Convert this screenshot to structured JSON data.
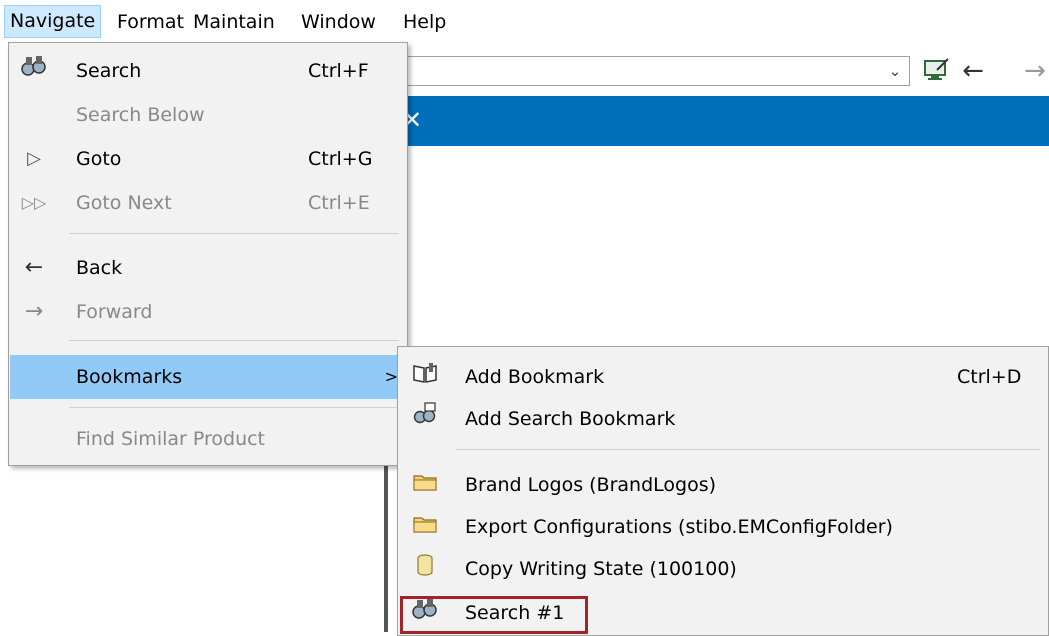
{
  "menubar": {
    "items": [
      "Navigate",
      "Format",
      "Maintain",
      "Window",
      "Help"
    ]
  },
  "toolbar": {
    "combo_arrow": "⌄",
    "icons": [
      "screen-edit-icon",
      "back-arrow-icon",
      "forward-arrow-icon"
    ]
  },
  "navigate_menu": {
    "items": [
      {
        "label": "Search",
        "shortcut": "Ctrl+F",
        "icon": "search-binoculars-icon",
        "enabled": true
      },
      {
        "label": "Search Below",
        "shortcut": "",
        "icon": "",
        "enabled": false
      },
      {
        "label": "Goto",
        "shortcut": "Ctrl+G",
        "icon": "play-triangle-icon",
        "enabled": true
      },
      {
        "label": "Goto Next",
        "shortcut": "Ctrl+E",
        "icon": "double-triangle-icon",
        "enabled": false
      },
      {
        "label": "Back",
        "shortcut": "",
        "icon": "back-arrow-icon",
        "enabled": true
      },
      {
        "label": "Forward",
        "shortcut": "",
        "icon": "forward-arrow-icon",
        "enabled": false
      },
      {
        "label": "Bookmarks",
        "shortcut": "",
        "icon": "",
        "enabled": true,
        "highlighted": true,
        "submenu_arrow": ">"
      },
      {
        "label": "Find Similar Product",
        "shortcut": "",
        "icon": "",
        "enabled": false
      }
    ]
  },
  "bookmarks_menu": {
    "items": [
      {
        "label": "Add Bookmark",
        "shortcut": "Ctrl+D",
        "icon": "open-book-icon"
      },
      {
        "label": "Add Search Bookmark",
        "shortcut": "",
        "icon": "search-bookmark-icon"
      },
      {
        "label": "Brand Logos (BrandLogos)",
        "shortcut": "",
        "icon": "folder-icon"
      },
      {
        "label": "Export Configurations (stibo.EMConfigFolder)",
        "shortcut": "",
        "icon": "folder-icon"
      },
      {
        "label": "Copy Writing State (100100)",
        "shortcut": "",
        "icon": "database-icon"
      },
      {
        "label": "Search #1",
        "shortcut": "",
        "icon": "search-binoculars-icon",
        "highlighted_box": true
      }
    ]
  },
  "colors": {
    "menu_bg": "#f2f2f2",
    "highlight": "#91c9f7",
    "band": "#006ebb",
    "selection_box": "#a3232b"
  }
}
